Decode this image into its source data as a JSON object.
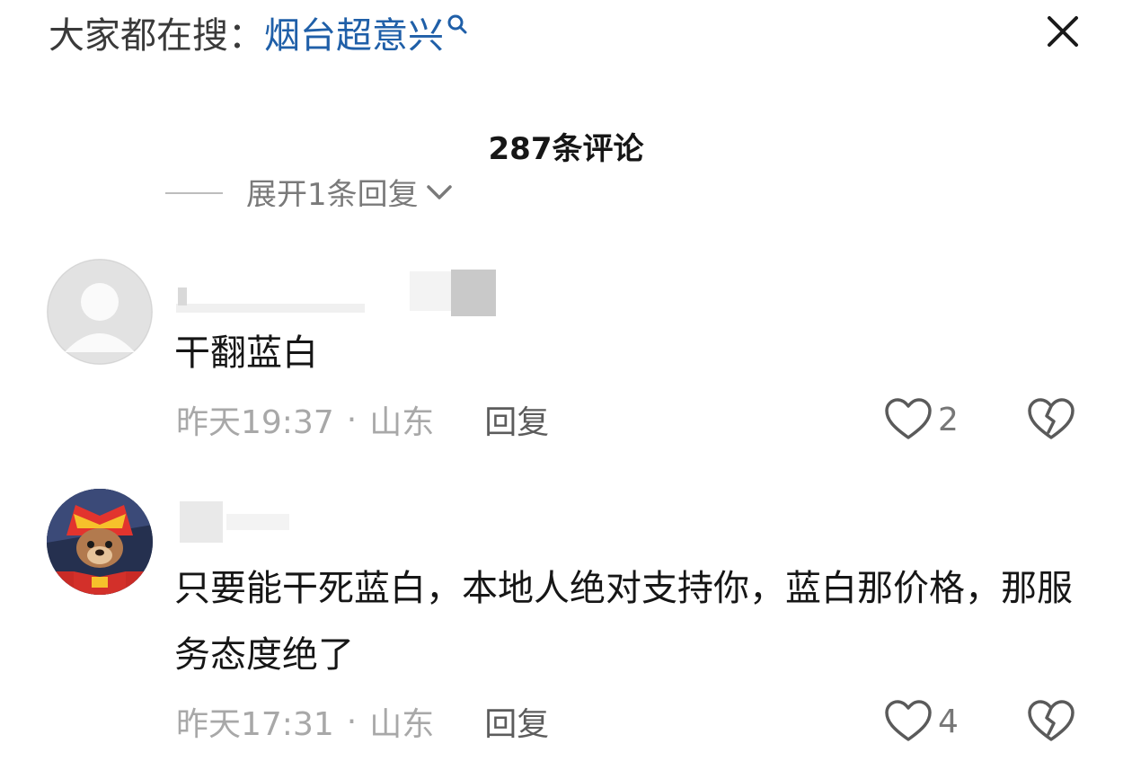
{
  "search": {
    "prefix": "大家都在搜：",
    "term": "烟台超意兴",
    "icon": "search-icon"
  },
  "header": {
    "comment_count": "287条评论",
    "close_icon": "close-icon"
  },
  "expand_replies": {
    "label": "展开1条回复"
  },
  "comments": [
    {
      "text": "干翻蓝白",
      "time": "昨天19:37",
      "separator": "·",
      "location": "山东",
      "reply_label": "回复",
      "likes": "2"
    },
    {
      "text": "只要能干死蓝白，本地人绝对支持你，蓝白那价格，那服务态度绝了",
      "time": "昨天17:31",
      "separator": "·",
      "location": "山东",
      "reply_label": "回复",
      "likes": "4"
    }
  ],
  "colors": {
    "search_term": "#1f5fa8",
    "meta": "#a8a8a8",
    "reply": "#5c5c5c"
  }
}
